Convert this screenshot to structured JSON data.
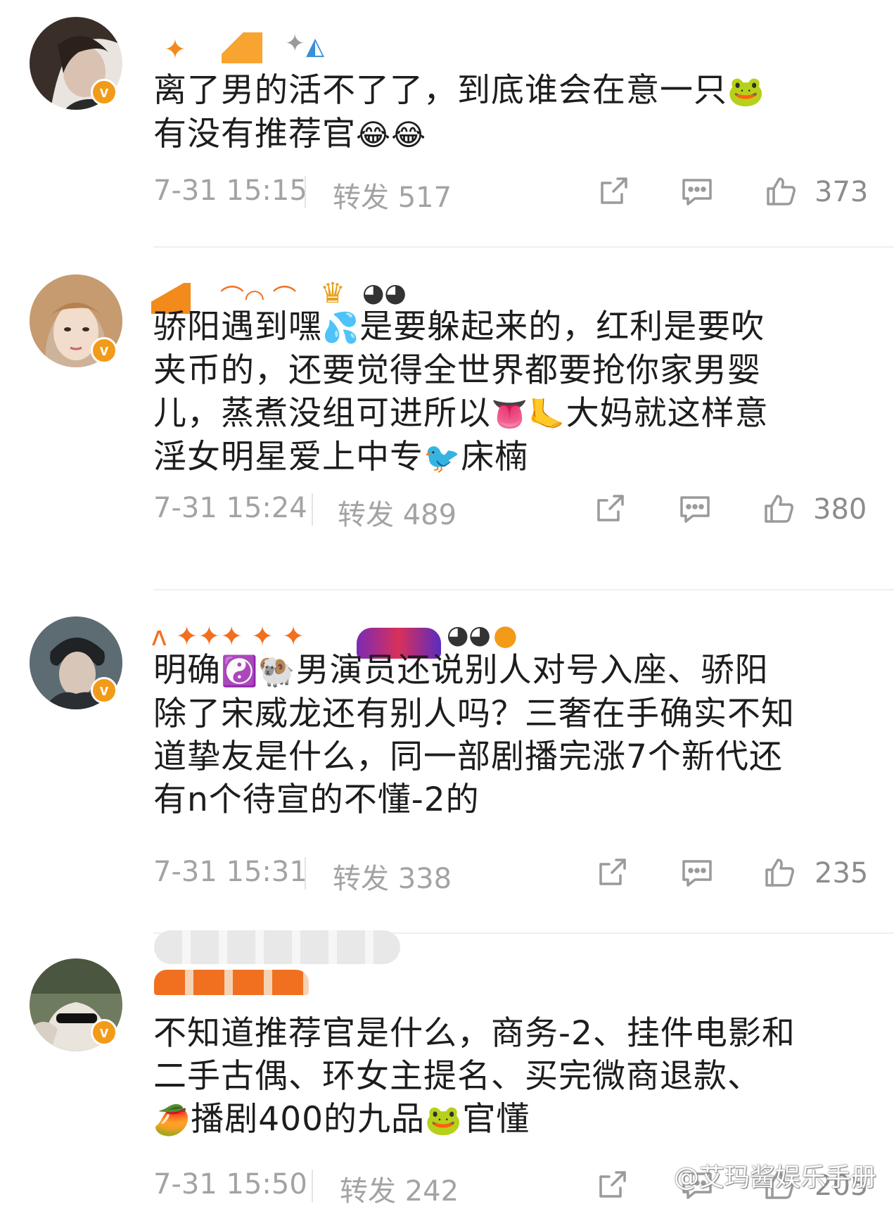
{
  "comments": [
    {
      "body_parts": [
        "离了男的活不了了，到底谁会在意一只",
        "🐸",
        "\n有没有推荐官",
        "😂😂"
      ],
      "time": "7-31 15:15",
      "repost": "转发 517",
      "likes": "373",
      "avatar_badge": "v"
    },
    {
      "body_parts": [
        "骄阳遇到嘿",
        "💦",
        "是要躲起来的，红利是要吹\n夹币的，还要觉得全世界都要抢你家男婴\n儿，蒸煮没组可进所以",
        "👅🦶",
        "大妈就这样意\n淫女明星爱上中专",
        "🐦",
        "床楠"
      ],
      "time": "7-31 15:24",
      "repost": "转发 489",
      "likes": "380",
      "avatar_badge": "v"
    },
    {
      "body_parts": [
        "明确",
        "☯️🐏",
        "男演员还说别人对号入座、骄阳\n除了宋威龙还有别人吗？三奢在手确实不知\n道挚友是什么，同一部剧播完涨7个新代还\n有n个待宣的不懂-2的"
      ],
      "time": "7-31 15:31",
      "repost": "转发 338",
      "likes": "235",
      "avatar_badge": "v"
    },
    {
      "body_parts": [
        "不知道推荐官是什么，商务-2、挂件电影和\n二手古偶、环女主提名、买完微商退款、\n",
        "🥭",
        "播剧400的九品",
        "🐸",
        "官懂"
      ],
      "time": "7-31 15:50",
      "repost": "转发 242",
      "likes": "205",
      "avatar_badge": "v"
    }
  ],
  "watermark": "@艾玛酱娱乐手册",
  "icons": [
    "share-icon",
    "comment-icon",
    "like-icon"
  ],
  "colors": {
    "accent": "#f29b19",
    "muted": "#a3a3a3"
  }
}
